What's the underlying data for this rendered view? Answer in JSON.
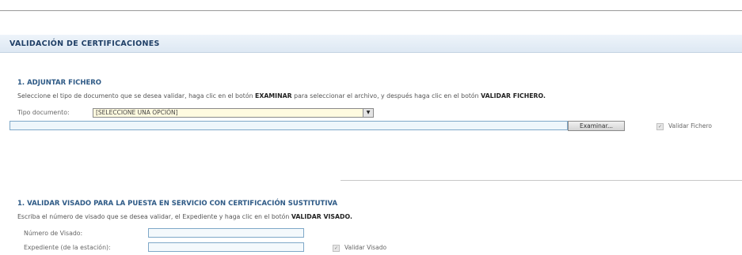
{
  "main": {
    "title": "VALIDACIÓN DE CERTIFICACIONES"
  },
  "section1": {
    "title": "1. ADJUNTAR FICHERO",
    "desc_part1": "Seleccione el tipo de documento que se desea validar, haga clic en el botón ",
    "desc_bold1": "EXAMINAR",
    "desc_part2": " para seleccionar el archivo, y después haga clic en el botón ",
    "desc_bold2": "VALIDAR FICHERO.",
    "tipo_label": "Tipo documento:",
    "tipo_value": "[SELECCIONE UNA OPCIÓN]",
    "file_value": "",
    "browse_label": "Examinar...",
    "validar_label": "Validar Fichero"
  },
  "section2": {
    "title": "1. VALIDAR VISADO PARA LA PUESTA EN SERVICIO CON CERTIFICACIÓN SUSTITUTIVA",
    "desc_part1": "Escriba el número de visado que se desea validar, el Expediente y haga clic en el botón ",
    "desc_bold1": "VALIDAR VISADO.",
    "visado_label": "Número de Visado:",
    "visado_value": "",
    "expediente_label": "Expediente (de la estación):",
    "expediente_value": "",
    "validar_label": "Validar Visado"
  },
  "icons": {
    "validar": "check-icon"
  }
}
